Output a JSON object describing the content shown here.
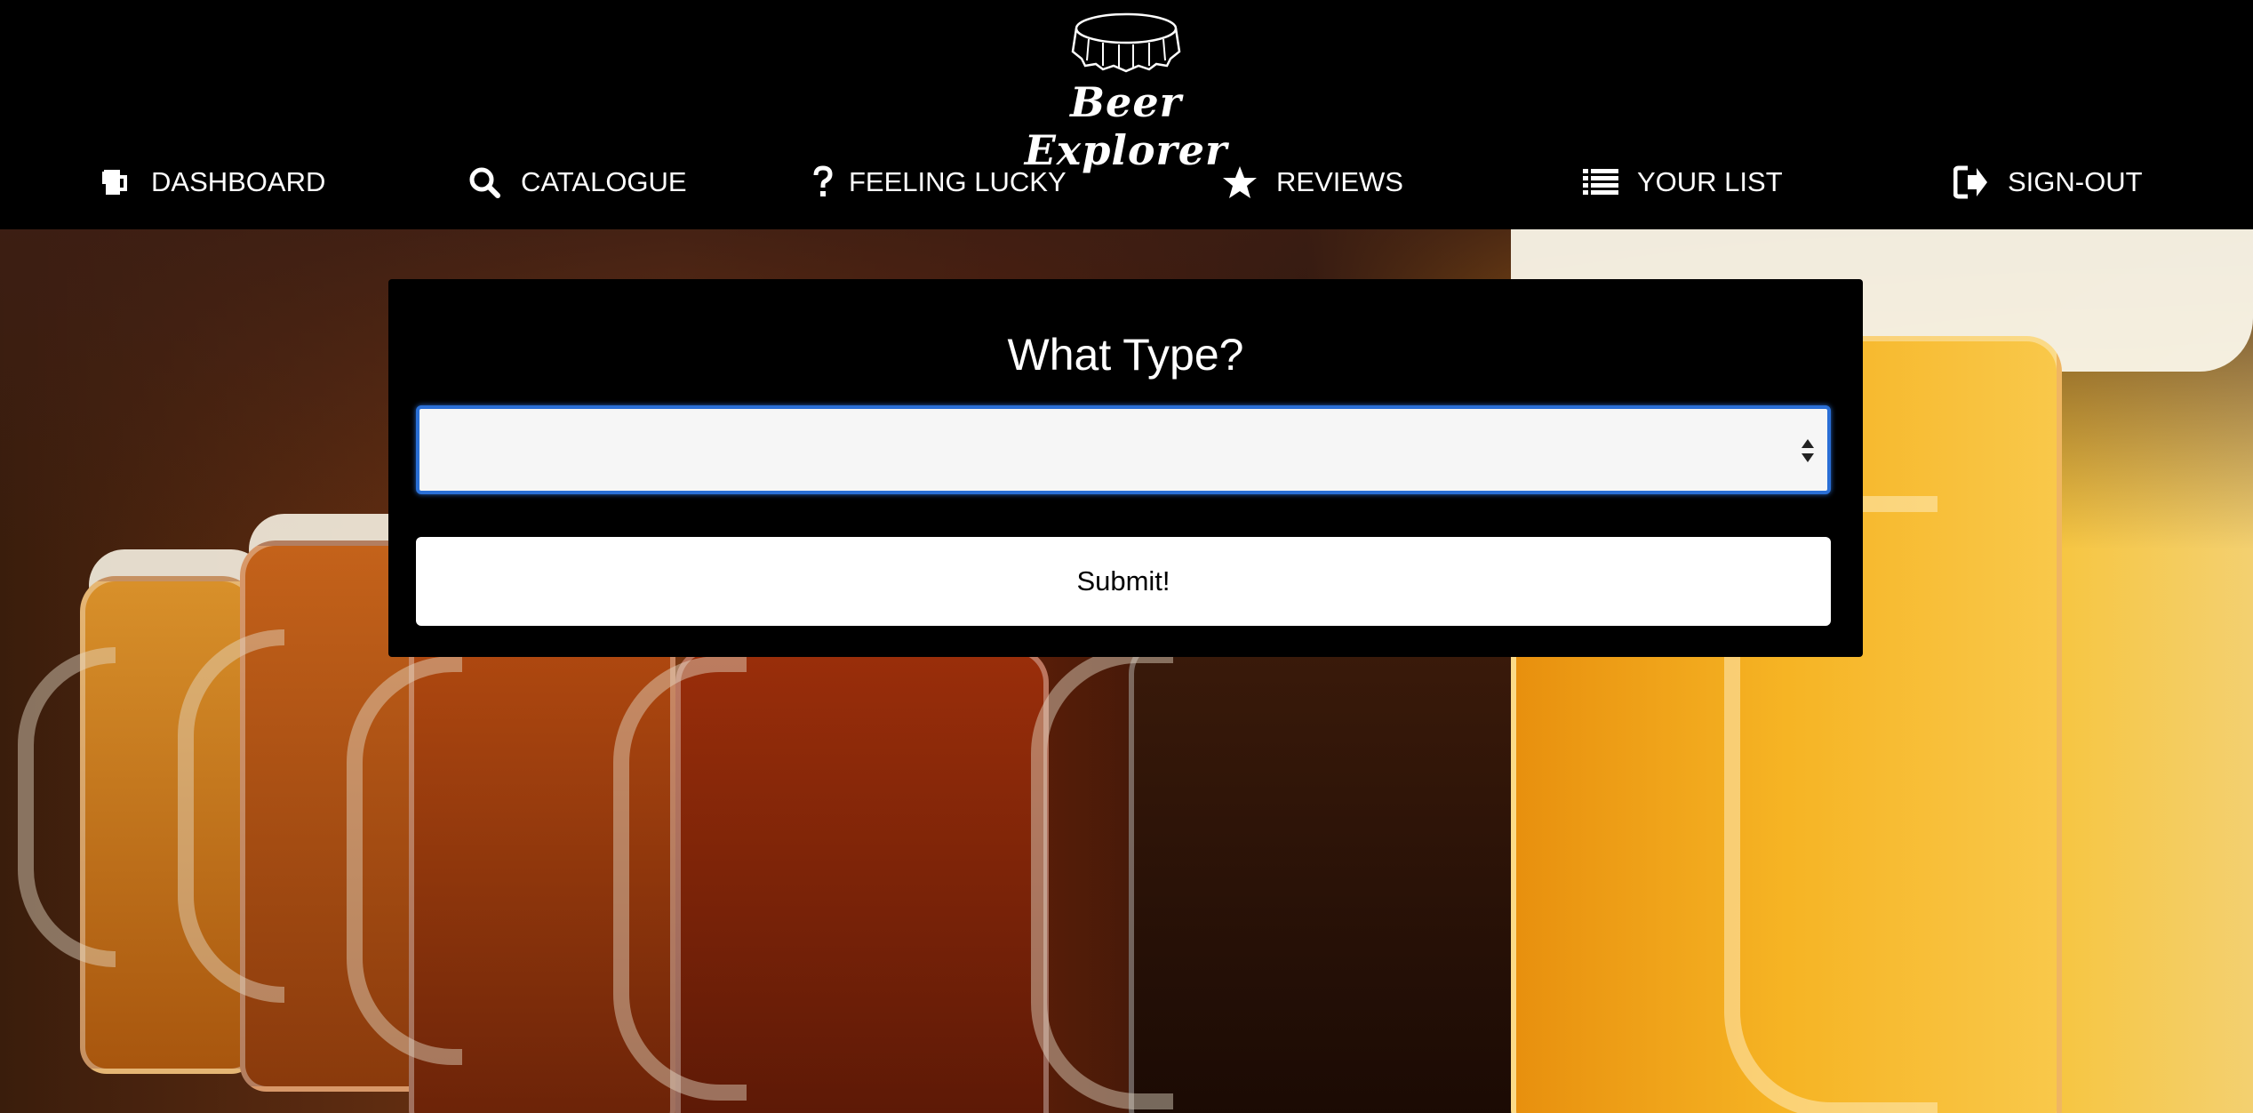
{
  "app": {
    "logo_text": "Beer Explorer",
    "logo_icon": "bottle-cap-icon"
  },
  "nav": {
    "items": [
      {
        "label": "DASHBOARD",
        "icon": "beer-mug-icon"
      },
      {
        "label": "CATALOGUE",
        "icon": "search-icon"
      },
      {
        "label": "FEELING LUCKY",
        "icon": "question-icon"
      },
      {
        "label": "REVIEWS",
        "icon": "star-icon"
      },
      {
        "label": "YOUR LIST",
        "icon": "list-icon"
      },
      {
        "label": "SIGN-OUT",
        "icon": "sign-out-icon"
      }
    ]
  },
  "form": {
    "title": "What Type?",
    "select_value": "",
    "submit_label": "Submit!"
  },
  "colors": {
    "header_bg": "#000000",
    "focus_ring": "#2a6fd6",
    "panel_bg": "#000000",
    "button_bg": "#ffffff"
  }
}
